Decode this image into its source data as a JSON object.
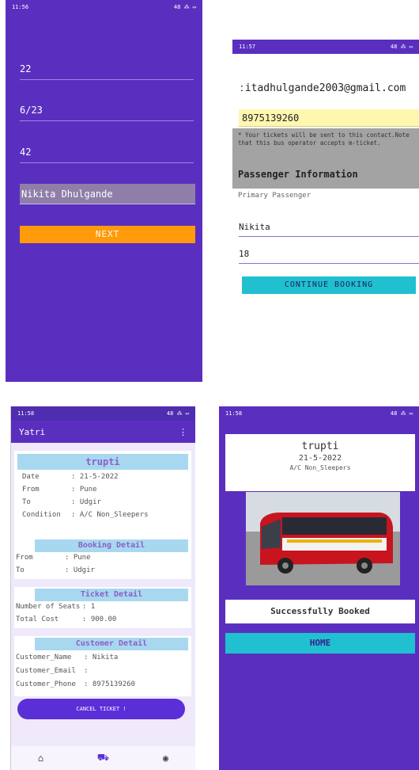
{
  "screen1": {
    "status_left": "11:56",
    "status_right": "48 ⁂ ▭",
    "fields": [
      "22",
      "6/23",
      "42"
    ],
    "name_value": "Nikita Dhulgande",
    "next_label": "NEXT"
  },
  "screen2": {
    "status_left": "11:57",
    "status_right": "48 ⁂ ▭",
    "email": "ːitadhulgande2003@gmail.com",
    "phone": "8975139260",
    "note": "* Your tickets will be sent to this contact.Note that this bus operator accepts m-ticket.",
    "passenger_info": "Passenger Information",
    "primary_label": "Primary Passenger",
    "first_name": "Nikita",
    "age": "18",
    "continue_label": "CONTINUE BOOKING"
  },
  "screen3": {
    "status_left": "11:58",
    "status_right": "48 ⁂ ▭",
    "app_title": "Yatri",
    "menu_icon": "⋮",
    "bus_name": "trupti",
    "date_key": "Date",
    "date_val": ": 21-5-2022",
    "from_key": "From",
    "from_val": ": Pune",
    "to_key": "To",
    "to_val": ": Udgir",
    "cond_key": "Condition",
    "cond_val": ": A/C Non_Sleepers",
    "booking_head": "Booking Detail",
    "bfrom_key": "From",
    "bfrom_val": ": Pune",
    "bto_key": "To",
    "bto_val": ": Udgir",
    "ticket_head": "Ticket Detail",
    "seats_key": "Number of Seats",
    "seats_val": ": 1",
    "cost_key": "Total Cost",
    "cost_val": ": 900.00",
    "customer_head": "Customer Detail",
    "cname_key": "Customer_Name",
    "cname_val": ": Nikita",
    "cemail_key": "Customer_Email",
    "cemail_val": ":",
    "cphone_key": "Customer_Phone",
    "cphone_val": ": 8975139260",
    "cancel_label": "CANCEL TICKET !",
    "nav_home": "⌂",
    "nav_bus": "⛟",
    "nav_profile": "◉"
  },
  "screen4": {
    "status_left": "11:58",
    "status_right": "48 ⁂ ▭",
    "bus_name": "trupti",
    "date": "21-5-2022",
    "condition": "A/C Non_Sleepers",
    "success": "Successfully Booked",
    "home_label": "HOME"
  }
}
